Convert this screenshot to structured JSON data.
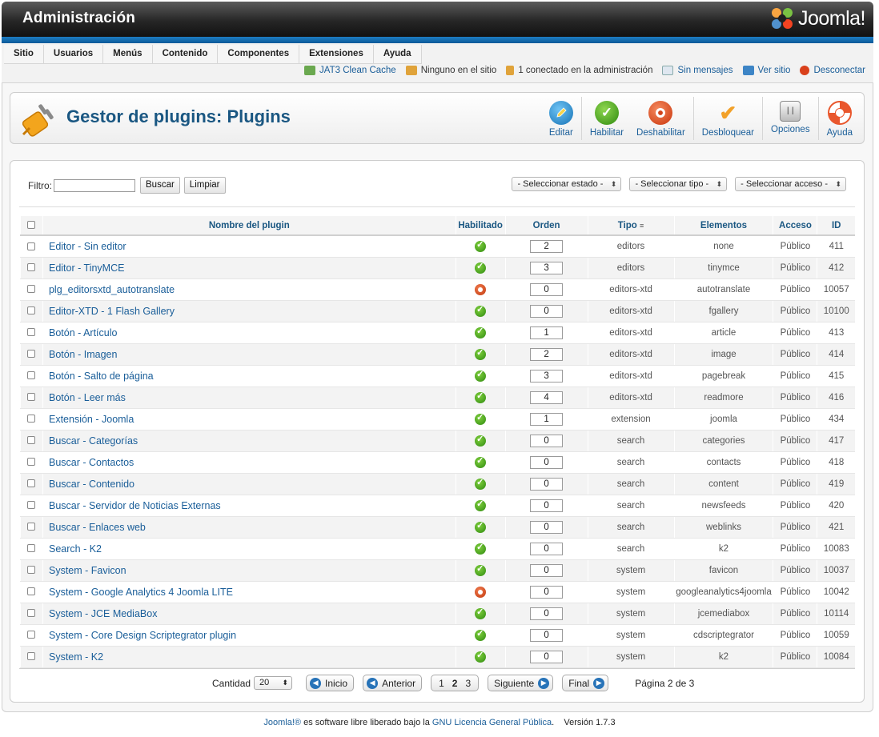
{
  "header": {
    "title": "Administración",
    "logo_text": "Joomla!"
  },
  "menu": [
    "Sitio",
    "Usuarios",
    "Menús",
    "Contenido",
    "Componentes",
    "Extensiones",
    "Ayuda"
  ],
  "status": {
    "cache": "JAT3 Clean Cache",
    "site_users": "Ninguno en el sitio",
    "admin_users": "1 conectado en la administración",
    "messages": "Sin mensajes",
    "view_site": "Ver sitio",
    "logout": "Desconectar"
  },
  "toolbar": {
    "title": "Gestor de plugins: Plugins",
    "buttons": [
      "Editar",
      "Habilitar",
      "Deshabilitar",
      "Desbloquear",
      "Opciones",
      "Ayuda"
    ]
  },
  "filter": {
    "label": "Filtro:",
    "value": "",
    "search_label": "Buscar",
    "clear_label": "Limpiar",
    "state_select": "- Seleccionar estado -",
    "type_select": "- Seleccionar tipo -",
    "access_select": "- Seleccionar acceso -"
  },
  "columns": [
    "Nombre del plugin",
    "Habilitado",
    "Orden",
    "Tipo",
    "Elementos",
    "Acceso",
    "ID"
  ],
  "rows": [
    {
      "name": "Editor - Sin editor",
      "enabled": true,
      "order": "2",
      "type": "editors",
      "element": "none",
      "access": "Público",
      "id": "411"
    },
    {
      "name": "Editor - TinyMCE",
      "enabled": true,
      "order": "3",
      "type": "editors",
      "element": "tinymce",
      "access": "Público",
      "id": "412"
    },
    {
      "name": "plg_editorsxtd_autotranslate",
      "enabled": false,
      "order": "0",
      "type": "editors-xtd",
      "element": "autotranslate",
      "access": "Público",
      "id": "10057"
    },
    {
      "name": "Editor-XTD - 1 Flash Gallery",
      "enabled": true,
      "order": "0",
      "type": "editors-xtd",
      "element": "fgallery",
      "access": "Público",
      "id": "10100"
    },
    {
      "name": "Botón - Artículo",
      "enabled": true,
      "order": "1",
      "type": "editors-xtd",
      "element": "article",
      "access": "Público",
      "id": "413"
    },
    {
      "name": "Botón - Imagen",
      "enabled": true,
      "order": "2",
      "type": "editors-xtd",
      "element": "image",
      "access": "Público",
      "id": "414"
    },
    {
      "name": "Botón - Salto de página",
      "enabled": true,
      "order": "3",
      "type": "editors-xtd",
      "element": "pagebreak",
      "access": "Público",
      "id": "415"
    },
    {
      "name": "Botón - Leer más",
      "enabled": true,
      "order": "4",
      "type": "editors-xtd",
      "element": "readmore",
      "access": "Público",
      "id": "416"
    },
    {
      "name": "Extensión - Joomla",
      "enabled": true,
      "order": "1",
      "type": "extension",
      "element": "joomla",
      "access": "Público",
      "id": "434"
    },
    {
      "name": "Buscar - Categorías",
      "enabled": true,
      "order": "0",
      "type": "search",
      "element": "categories",
      "access": "Público",
      "id": "417"
    },
    {
      "name": "Buscar - Contactos",
      "enabled": true,
      "order": "0",
      "type": "search",
      "element": "contacts",
      "access": "Público",
      "id": "418"
    },
    {
      "name": "Buscar - Contenido",
      "enabled": true,
      "order": "0",
      "type": "search",
      "element": "content",
      "access": "Público",
      "id": "419"
    },
    {
      "name": "Buscar - Servidor de Noticias Externas",
      "enabled": true,
      "order": "0",
      "type": "search",
      "element": "newsfeeds",
      "access": "Público",
      "id": "420"
    },
    {
      "name": "Buscar - Enlaces web",
      "enabled": true,
      "order": "0",
      "type": "search",
      "element": "weblinks",
      "access": "Público",
      "id": "421"
    },
    {
      "name": "Search - K2",
      "enabled": true,
      "order": "0",
      "type": "search",
      "element": "k2",
      "access": "Público",
      "id": "10083"
    },
    {
      "name": "System - Favicon",
      "enabled": true,
      "order": "0",
      "type": "system",
      "element": "favicon",
      "access": "Público",
      "id": "10037"
    },
    {
      "name": "System - Google Analytics 4 Joomla LITE",
      "enabled": false,
      "order": "0",
      "type": "system",
      "element": "googleanalytics4joomla",
      "access": "Público",
      "id": "10042"
    },
    {
      "name": "System - JCE MediaBox",
      "enabled": true,
      "order": "0",
      "type": "system",
      "element": "jcemediabox",
      "access": "Público",
      "id": "10114"
    },
    {
      "name": "System - Core Design Scriptegrator plugin",
      "enabled": true,
      "order": "0",
      "type": "system",
      "element": "cdscriptegrator",
      "access": "Público",
      "id": "10059"
    },
    {
      "name": "System - K2",
      "enabled": true,
      "order": "0",
      "type": "system",
      "element": "k2",
      "access": "Público",
      "id": "10084"
    }
  ],
  "pagination": {
    "count_label": "Cantidad",
    "count_value": "20",
    "start": "Inicio",
    "prev": "Anterior",
    "pages": [
      "1",
      "2",
      "3"
    ],
    "current_page": "2",
    "next": "Siguiente",
    "end": "Final",
    "page_info": "Página 2 de 3"
  },
  "footer": {
    "brand": "Joomla!®",
    "text": " es software libre liberado bajo la ",
    "license": "GNU Licencia General Pública",
    "version": ".    Versión 1.7.3"
  },
  "colors": {
    "header_dark": "#1e1e1e",
    "accent_blue": "#1d7dc4",
    "link": "#1a5e99",
    "enabled": "#3d9b1a",
    "disabled": "#d24a1c"
  },
  "icons": [
    "plugin-icon",
    "edit-icon",
    "publish-icon",
    "unpublish-icon",
    "checkin-icon",
    "options-icon",
    "help-icon"
  ]
}
